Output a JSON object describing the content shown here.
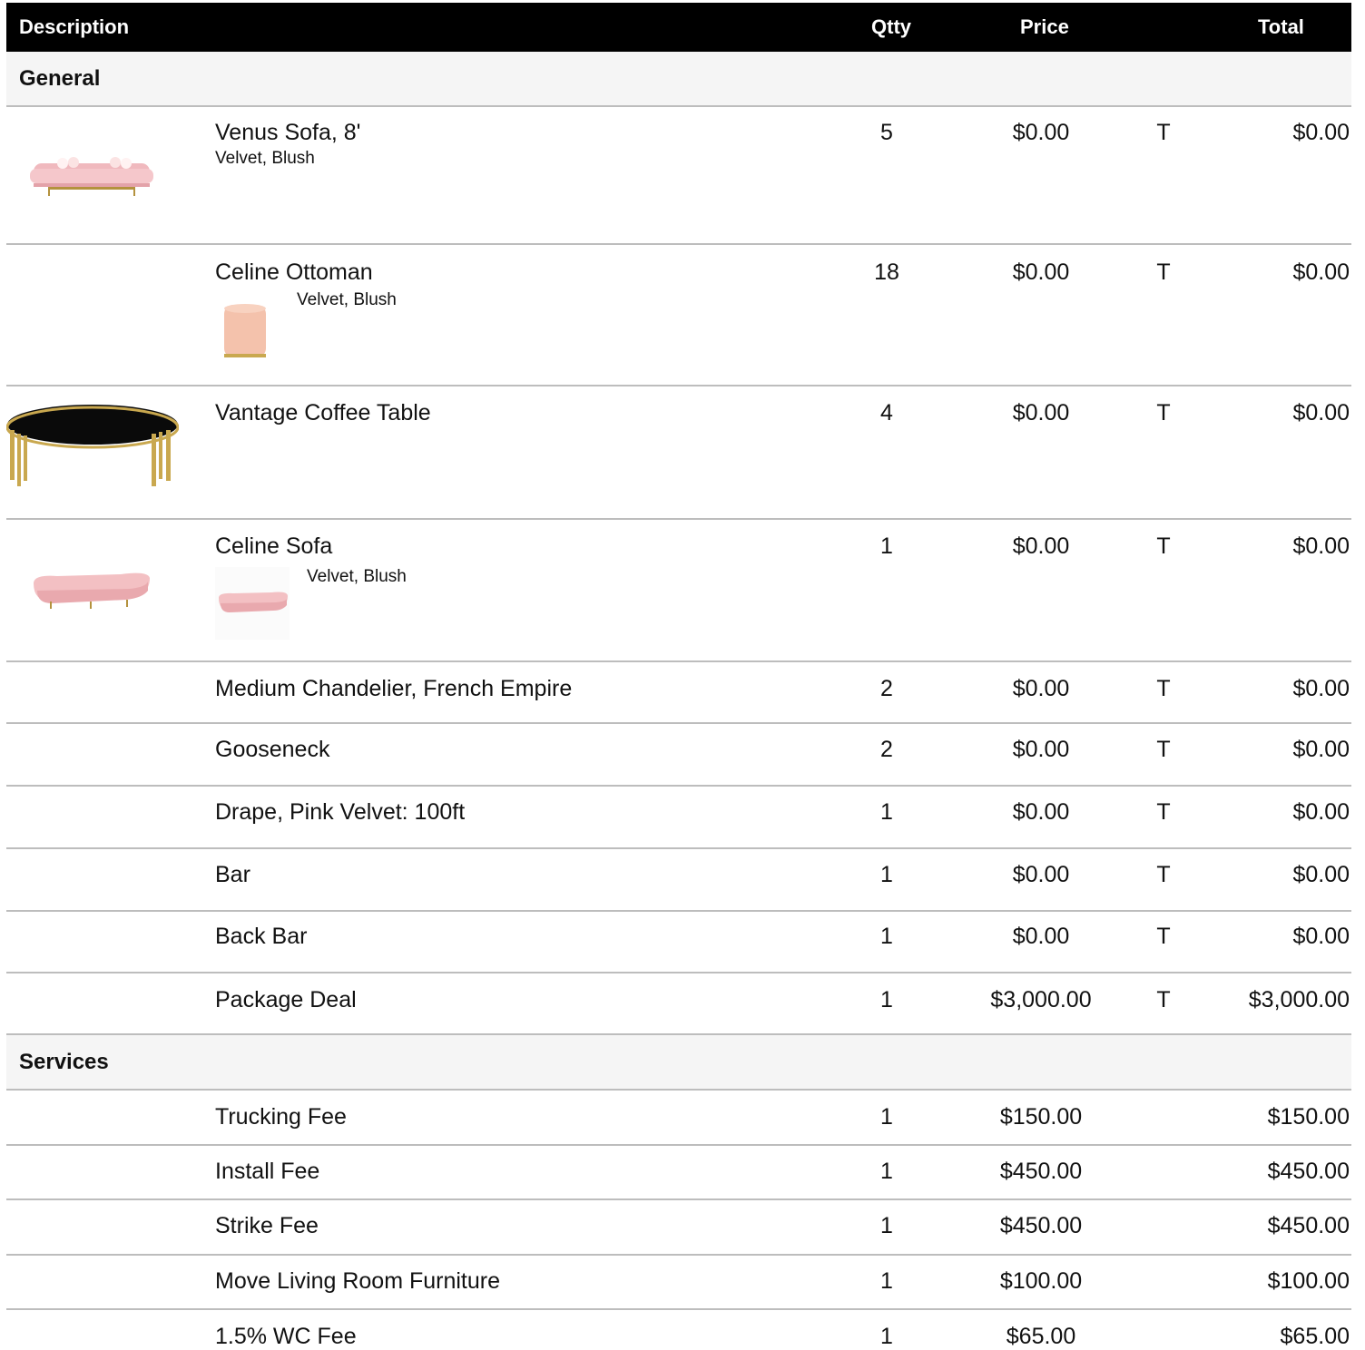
{
  "header": {
    "description": "Description",
    "qty": "Qtty",
    "price": "Price",
    "total": "Total"
  },
  "sections": [
    {
      "name": "General",
      "items": [
        {
          "desc": "Venus Sofa, 8'",
          "sub": "Velvet, Blush",
          "qty": "5",
          "price": "$0.00",
          "tax": "T",
          "total": "$0.00"
        },
        {
          "desc": "Celine Ottoman",
          "sub": "Velvet, Blush",
          "qty": "18",
          "price": "$0.00",
          "tax": "T",
          "total": "$0.00"
        },
        {
          "desc": "Vantage Coffee Table",
          "qty": "4",
          "price": "$0.00",
          "tax": "T",
          "total": "$0.00"
        },
        {
          "desc": "Celine Sofa",
          "sub": "Velvet, Blush",
          "qty": "1",
          "price": "$0.00",
          "tax": "T",
          "total": "$0.00"
        },
        {
          "desc": "Medium Chandelier, French Empire",
          "qty": "2",
          "price": "$0.00",
          "tax": "T",
          "total": "$0.00"
        },
        {
          "desc": "Gooseneck",
          "qty": "2",
          "price": "$0.00",
          "tax": "T",
          "total": "$0.00"
        },
        {
          "desc": "Drape, Pink Velvet: 100ft",
          "qty": "1",
          "price": "$0.00",
          "tax": "T",
          "total": "$0.00"
        },
        {
          "desc": "Bar",
          "qty": "1",
          "price": "$0.00",
          "tax": "T",
          "total": "$0.00"
        },
        {
          "desc": "Back Bar",
          "qty": "1",
          "price": "$0.00",
          "tax": "T",
          "total": "$0.00"
        },
        {
          "desc": "Package Deal",
          "qty": "1",
          "price": "$3,000.00",
          "tax": "T",
          "total": "$3,000.00"
        }
      ]
    },
    {
      "name": "Services",
      "items": [
        {
          "desc": "Trucking Fee",
          "qty": "1",
          "price": "$150.00",
          "total": "$150.00"
        },
        {
          "desc": "Install Fee",
          "qty": "1",
          "price": "$450.00",
          "total": "$450.00"
        },
        {
          "desc": "Strike Fee",
          "qty": "1",
          "price": "$450.00",
          "total": "$450.00"
        },
        {
          "desc": "Move Living Room Furniture",
          "qty": "1",
          "price": "$100.00",
          "total": "$100.00"
        },
        {
          "desc": "1.5% WC Fee",
          "qty": "1",
          "price": "$65.00",
          "total": "$65.00"
        }
      ]
    }
  ],
  "icons": {
    "venus_sofa": "pink-sofa-image",
    "ottoman": "pink-ottoman-image",
    "coffee_table": "black-gold-coffee-table-image",
    "celine_sofa": "curved-pink-sofa-image"
  },
  "colors": {
    "header_bg": "#000000",
    "section_bg": "#f5f5f5",
    "divider": "#bdbdbd",
    "velvet_pink": "#f2b7bd",
    "gold": "#c9a84f"
  }
}
